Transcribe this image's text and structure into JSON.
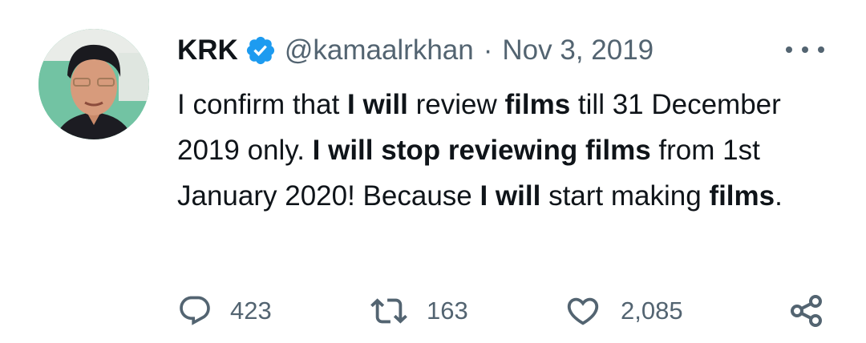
{
  "user": {
    "display_name": "KRK",
    "handle": "@kamaalrkhan",
    "separator": "·",
    "date": "Nov 3, 2019",
    "verified": true
  },
  "tweet": {
    "segments": [
      {
        "text": "I confirm that ",
        "bold": false
      },
      {
        "text": "I will",
        "bold": true
      },
      {
        "text": " review ",
        "bold": false
      },
      {
        "text": "films",
        "bold": true
      },
      {
        "text": " till 31 December 2019 only. ",
        "bold": false
      },
      {
        "text": "I will stop reviewing films",
        "bold": true
      },
      {
        "text": " from 1st January 2020! Because ",
        "bold": false
      },
      {
        "text": "I will",
        "bold": true
      },
      {
        "text": " start making ",
        "bold": false
      },
      {
        "text": "films",
        "bold": true
      },
      {
        "text": ".",
        "bold": false
      }
    ]
  },
  "actions": {
    "reply_count": "423",
    "retweet_count": "163",
    "like_count": "2,085"
  },
  "icons": {
    "verified": "verified-badge-icon",
    "more": "more-options-icon",
    "reply": "reply-icon",
    "retweet": "retweet-icon",
    "like": "heart-icon",
    "share": "share-icon"
  },
  "colors": {
    "text": "#0f1419",
    "secondary": "#536471",
    "verified_blue": "#1d9bf0"
  }
}
